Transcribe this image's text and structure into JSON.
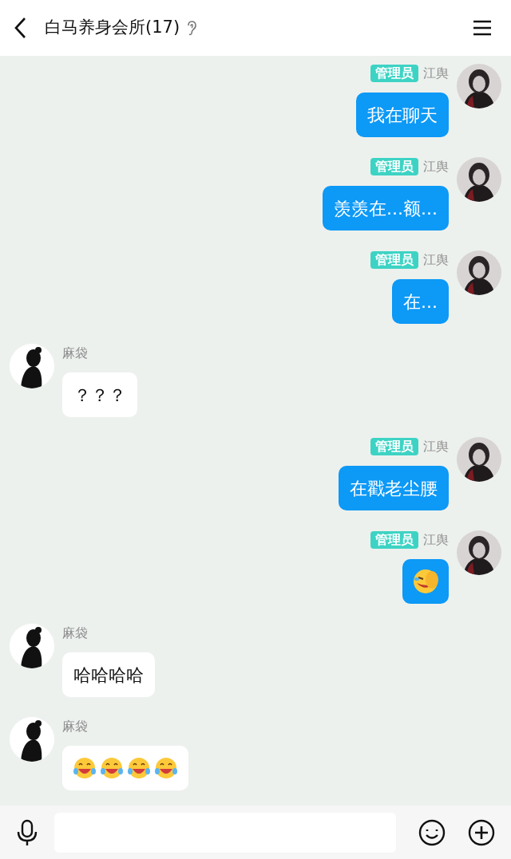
{
  "header": {
    "title": "白马养身会所(17)"
  },
  "messages": [
    {
      "outgoing": true,
      "role": "管理员",
      "sender": "江舆",
      "kind": "text",
      "text": "我在聊天"
    },
    {
      "outgoing": true,
      "role": "管理员",
      "sender": "江舆",
      "kind": "text",
      "text": "羡羡在...额..."
    },
    {
      "outgoing": true,
      "role": "管理员",
      "sender": "江舆",
      "kind": "text",
      "text": "在..."
    },
    {
      "outgoing": false,
      "sender": "麻袋",
      "kind": "text",
      "text": "？？？"
    },
    {
      "outgoing": true,
      "role": "管理员",
      "sender": "江舆",
      "kind": "text",
      "text": "在戳老尘腰"
    },
    {
      "outgoing": true,
      "role": "管理员",
      "sender": "江舆",
      "kind": "stickers",
      "stickers": [
        {
          "kind": "facepalm-laugh"
        }
      ]
    },
    {
      "outgoing": false,
      "sender": "麻袋",
      "kind": "text",
      "text": "哈哈哈哈"
    },
    {
      "outgoing": false,
      "sender": "麻袋",
      "kind": "stickers",
      "stickers": [
        {
          "kind": "tears-of-joy"
        },
        {
          "kind": "tears-of-joy"
        },
        {
          "kind": "tears-of-joy"
        },
        {
          "kind": "tears-of-joy"
        }
      ]
    }
  ]
}
